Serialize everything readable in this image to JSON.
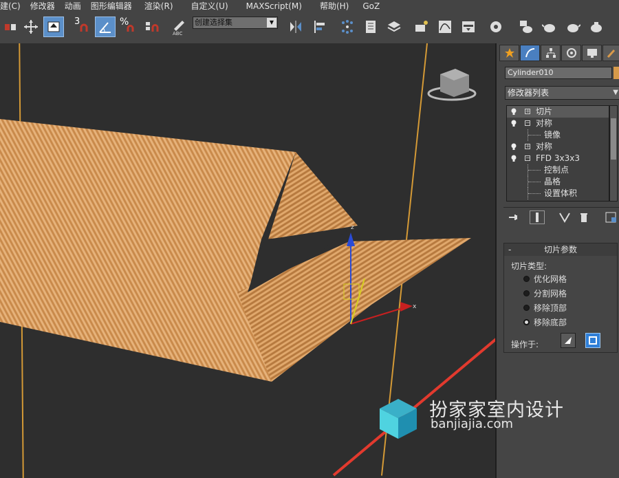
{
  "menubar": {
    "items": [
      "建(C)",
      "修改器",
      "动画",
      "图形编辑器",
      "渲染(R)",
      "自定义(U)",
      "MAXScript(M)",
      "帮助(H)",
      "GoZ"
    ]
  },
  "toolbar": {
    "snap_label": "3",
    "angle_snap_label": "%",
    "selection_set_placeholder": "创建选择集"
  },
  "panel": {
    "object_name": "Cylinder010",
    "modifier_list": "修改器列表",
    "stack": [
      {
        "label": "切片",
        "type": "mod",
        "box": "+"
      },
      {
        "label": "对称",
        "type": "mod",
        "box": "−"
      },
      {
        "label": "镜像",
        "type": "sub"
      },
      {
        "label": "对称",
        "type": "mod",
        "box": "+"
      },
      {
        "label": "FFD 3x3x3",
        "type": "mod",
        "box": "−"
      },
      {
        "label": "控制点",
        "type": "sub"
      },
      {
        "label": "晶格",
        "type": "sub"
      },
      {
        "label": "设置体积",
        "type": "sub"
      }
    ],
    "rollout_title": "切片参数",
    "rollout_toggle": "-",
    "slice_type_label": "切片类型:",
    "slice_options": [
      "优化网格",
      "分割网格",
      "移除顶部",
      "移除底部"
    ],
    "selected_option": 3,
    "operate_on_label": "操作于:"
  },
  "viewport": {
    "gizmo_z": "z",
    "gizmo_x": "x"
  },
  "watermark": {
    "title": "扮家家室内设计",
    "url": "banjiajia.com"
  },
  "colors": {
    "ui_bg": "#444444",
    "viewport_bg": "#2e2e2e",
    "object": "#d89c5a",
    "active_blue": "#5b8fc9",
    "arrow_red": "#e23a2e"
  }
}
